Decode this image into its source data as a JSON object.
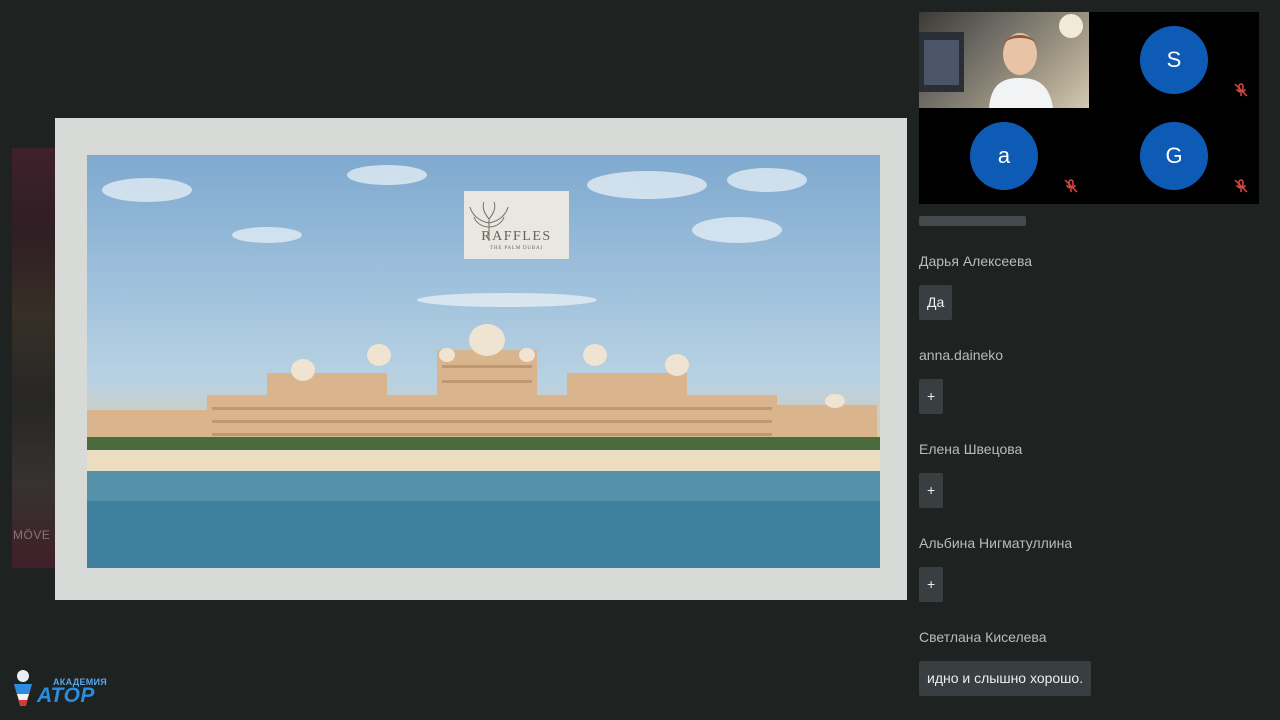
{
  "slide": {
    "logo_title": "RAFFLES",
    "logo_subtitle": "THE PALM DUBAI",
    "side_strip_text": "MÖVE"
  },
  "video_grid": {
    "tiles": [
      {
        "type": "camera"
      },
      {
        "type": "avatar",
        "initial": "S",
        "muted": true
      },
      {
        "type": "avatar",
        "initial": "a",
        "muted": true
      },
      {
        "type": "avatar",
        "initial": "G",
        "muted": true
      }
    ],
    "avatar_color": "#0d5bb5",
    "muted_icon": "mic-off-icon",
    "muted_color": "#e0453f"
  },
  "chat": {
    "messages": [
      {
        "name": "Дарья Алексеева",
        "text": "Да"
      },
      {
        "name": "anna.daineko",
        "text": "+"
      },
      {
        "name": "Елена Швецова",
        "text": "+"
      },
      {
        "name": "Альбина Нигматуллина",
        "text": "+"
      },
      {
        "name": "Светлана Киселева",
        "text": "идно и слышно хорошо."
      }
    ]
  },
  "brand": {
    "top": "АКАДЕМИЯ",
    "main": "АТОР"
  }
}
